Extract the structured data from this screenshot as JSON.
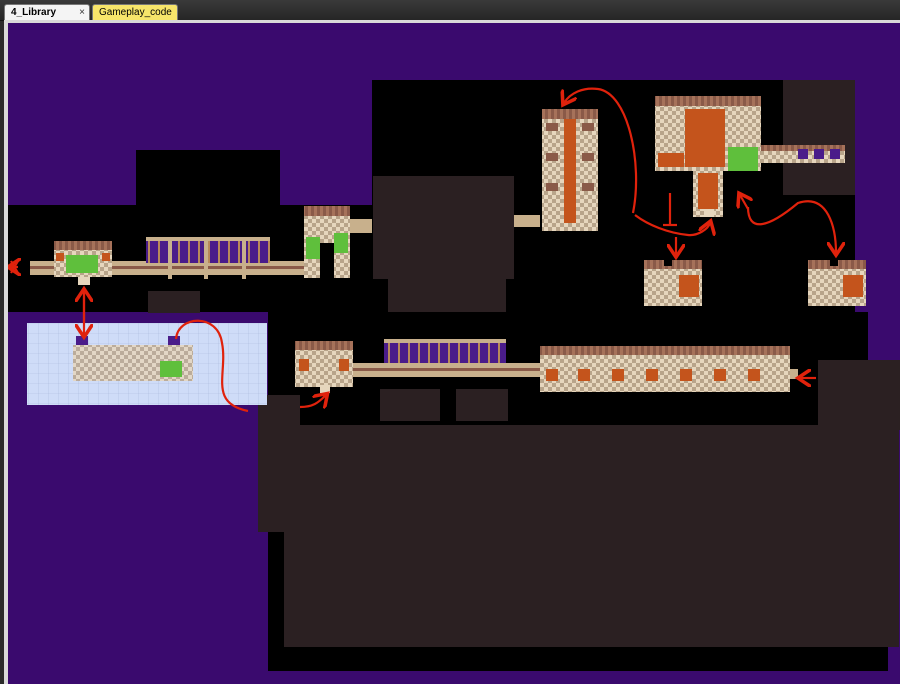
{
  "tabs": [
    {
      "label": "4_Library",
      "active": true,
      "close_glyph": "×"
    },
    {
      "label": "Gameplay_code",
      "active": false
    }
  ],
  "colors": {
    "background_void": "#3a0a6e",
    "unpainted": "#000000",
    "shadow_block": "#2b2022",
    "floor_light": "#e6d6bd",
    "floor_dark": "#b8a48a",
    "wall": "#8a5a48",
    "carpet": "#c4541c",
    "pipe": "#c8b08c",
    "bookshelf": "#4a1c8a",
    "plant": "#5fbf3c",
    "arrow": "#e0220c",
    "blueprint": "#cfdcf8"
  }
}
